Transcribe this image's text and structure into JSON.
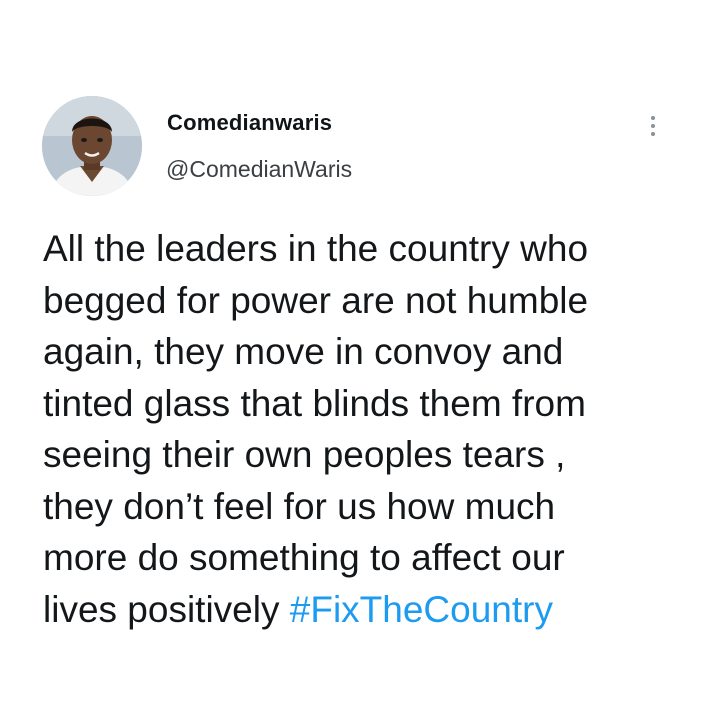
{
  "tweet": {
    "author": {
      "display_name": "Comedianwaris",
      "handle": "@ComedianWaris"
    },
    "more_icon": "more-vertical-icon",
    "text": "All the leaders in the country who\nbegged for power are not humble\nagain, they move in convoy and\ntinted glass that blinds them from\nseeing their own peoples tears ,\nthey don’t feel for us how much\nmore do something to affect our\nlives positively ",
    "hashtag": "#FixTheCountry"
  },
  "colors": {
    "hashtag": "#1d9bf0",
    "text": "#14171a",
    "background": "#ffffff"
  }
}
